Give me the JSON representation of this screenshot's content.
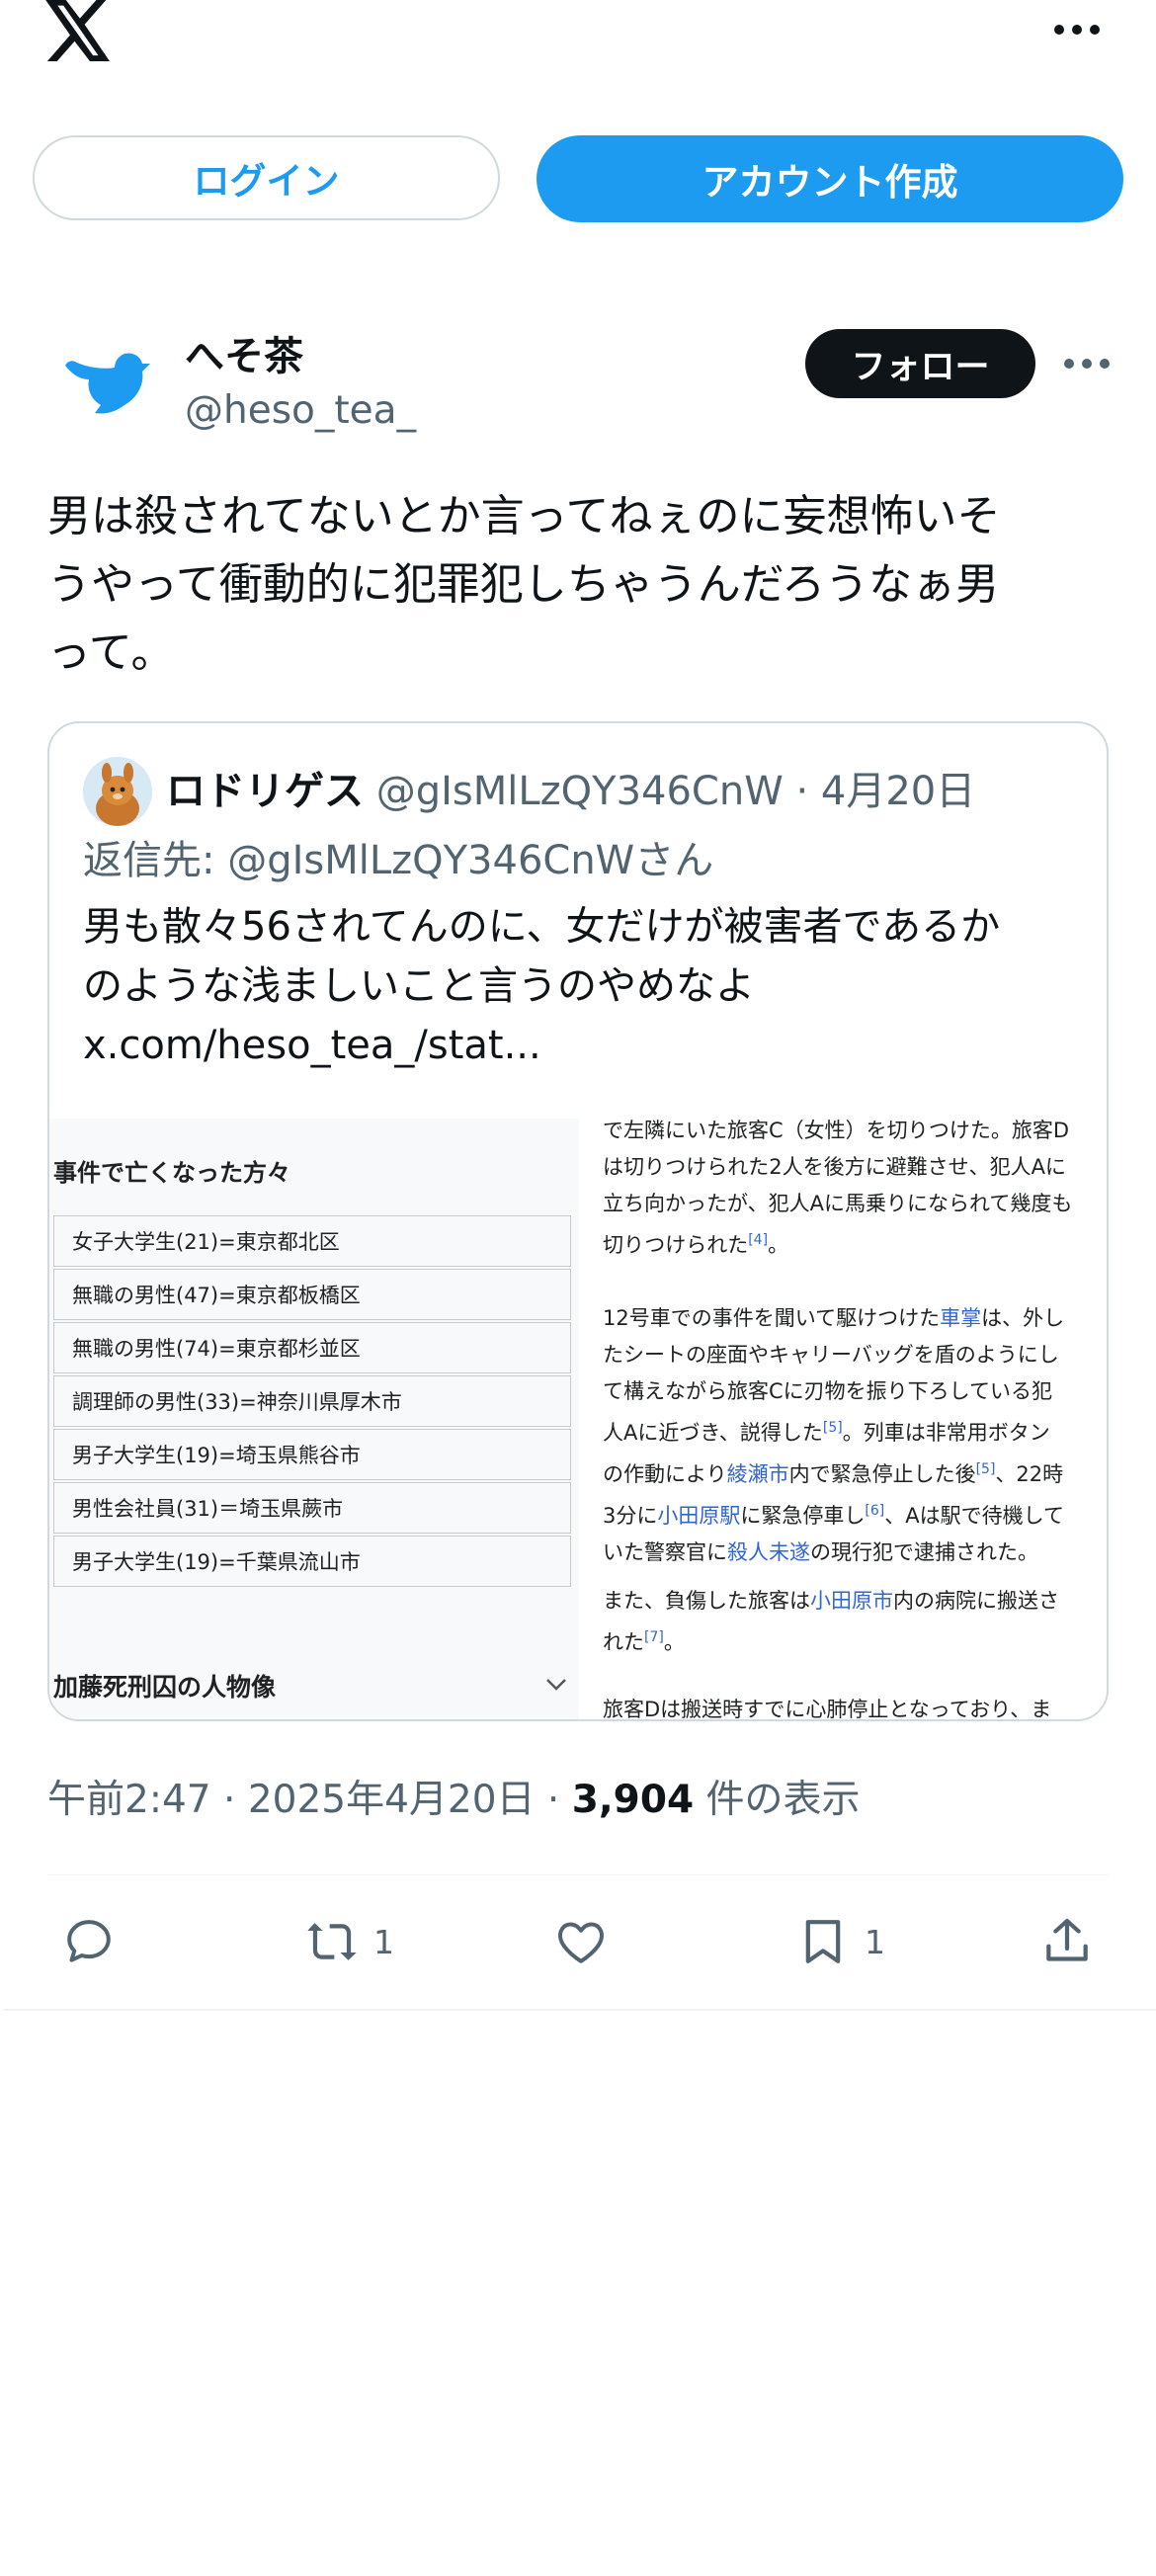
{
  "topbar": {
    "logo_icon": "x-logo-icon",
    "more_icon": "more-horizontal-icon",
    "login_label": "ログイン",
    "signup_label": "アカウント作成"
  },
  "post": {
    "author_name": "へそ茶",
    "author_handle": "@heso_tea_",
    "follow_label": "フォロー",
    "text_lines": [
      "男は殺されてないとか言ってねぇのに妄想怖いそ",
      "うやって衝動的に犯罪犯しちゃうんだろうなぁ男",
      "って。"
    ],
    "timestamp_time": "午前2:47",
    "timestamp_sep1": "·",
    "timestamp_date": "2025年4月20日",
    "timestamp_sep2": "·",
    "views_count": "3,904",
    "views_label": "件の表示"
  },
  "quote": {
    "author_name": "ロドリゲス",
    "author_handle": "@gIsMlLzQY346CnW",
    "sep": "·",
    "date": "4月20日",
    "reply_to": "返信先: @gIsMlLzQY346CnWさん",
    "text_lines": [
      "男も散々56されてんのに、女だけが被害者であるか",
      "のような浅ましいこと言うのやめなよ",
      "x.com/heso_tea_/stat..."
    ],
    "image": {
      "left_title": "事件で亡くなった方々",
      "rows": [
        "女子大学生(21)=東京都北区",
        "無職の男性(47)=東京都板橋区",
        "無職の男性(74)=東京都杉並区",
        "調理師の男性(33)=神奈川県厚木市",
        "男子大学生(19)=埼玉県熊谷市",
        "男性会社員(31)＝埼玉県蕨市",
        "男子大学生(19)=千葉県流山市"
      ],
      "left_section": "加藤死刑囚の人物像",
      "p1_lines": [
        "で左隣にいた旅客C（女性）を切りつけた。旅客D",
        "は切りつけられた2人を後方に避難させ、犯人Aに",
        "立ち向かったが、犯人Aに馬乗りになられて幾度も",
        "切りつけられた"
      ],
      "p1_ref": "[4]",
      "p2_l1a": "12号車での事件を聞いて駆けつけた",
      "p2_link1": "車掌",
      "p2_l1b": "は、外し",
      "p2_l2": "たシートの座面やキャリーバッグを盾のようにし",
      "p2_l3": "て構えながら旅客Cに刃物を振り下ろしている犯",
      "p2_l4a": "人Aに近づき、説得した",
      "p2_ref5": "[5]",
      "p2_l4b": "。列車は非常用ボタン",
      "p2_l5a": "の作動により",
      "p2_link2": "綾瀬市",
      "p2_l5b": "内で緊急停止した後",
      "p2_ref5b": "[5]",
      "p2_l5c": "、22時",
      "p2_l6a": "3分に",
      "p2_link3": "小田原駅",
      "p2_l6b": "に緊急停車し",
      "p2_ref6": "[6]",
      "p2_l6c": "、Aは駅で待機して",
      "p2_l7a": "いた警察官に",
      "p2_link4": "殺人未遂",
      "p2_l7b": "の現行犯で逮捕された。",
      "p3_l1a": "また、負傷した旅客は",
      "p3_link": "小田原市",
      "p3_l1b": "内の病院に搬送さ",
      "p3_l2": "れた",
      "p3_ref": "[7]",
      "p4_l1": "旅客Dは搬送時すでに心肺停止となっており、ま"
    }
  },
  "actions": {
    "reply_icon": "reply-icon",
    "retweet_icon": "retweet-icon",
    "retweet_count": "1",
    "like_icon": "heart-icon",
    "bookmark_icon": "bookmark-icon",
    "bookmark_count": "1",
    "share_icon": "share-icon"
  },
  "colors": {
    "accent": "#1d9bf0",
    "text": "#0f1419",
    "muted": "#536471",
    "border": "#cfd9de",
    "wiki_link": "#3366cc"
  }
}
